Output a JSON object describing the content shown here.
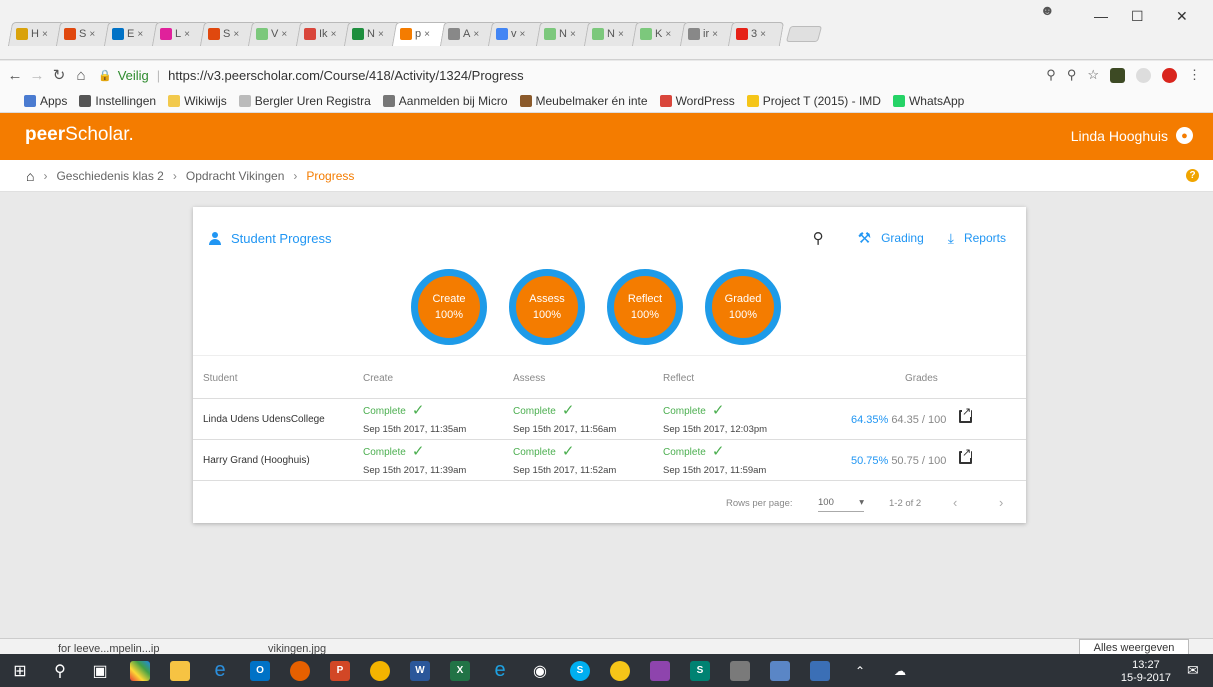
{
  "browser": {
    "tabs": [
      {
        "label": "H",
        "color": "#d9a20b"
      },
      {
        "label": "S",
        "color": "#e0480e"
      },
      {
        "label": "E",
        "color": "#0072c6"
      },
      {
        "label": "L",
        "color": "#e0219b"
      },
      {
        "label": "S",
        "color": "#e0480e"
      },
      {
        "label": "V",
        "color": "#7cc87c"
      },
      {
        "label": "Ik",
        "color": "#d9463b"
      },
      {
        "label": "N",
        "color": "#1e8e3e"
      },
      {
        "label": "p",
        "color": "#f47c00",
        "active": true
      },
      {
        "label": "A",
        "color": "#888888"
      },
      {
        "label": "v",
        "color": "#4285f4"
      },
      {
        "label": "N",
        "color": "#7cc87c"
      },
      {
        "label": "N",
        "color": "#7cc87c"
      },
      {
        "label": "K",
        "color": "#7cc87c"
      },
      {
        "label": "ir",
        "color": "#888888"
      },
      {
        "label": "3",
        "color": "#e62117"
      }
    ],
    "tab_close": "×",
    "secure_label": "Veilig",
    "url": "https://v3.peerscholar.com/Course/418/Activity/1324/Progress",
    "window_controls": {
      "minimize": "—",
      "maximize": "☐",
      "close": "✕"
    },
    "bookmarks": [
      {
        "label": "Apps",
        "color": "#4a7bd0"
      },
      {
        "label": "Instellingen",
        "color": "#555555"
      },
      {
        "label": "Wikiwijs",
        "color": "#f2c94c"
      },
      {
        "label": "Bergler Uren Registra",
        "color": "#bbbbbb"
      },
      {
        "label": "Aanmelden bij Micro",
        "color": "#777777"
      },
      {
        "label": "Meubelmaker én inte",
        "color": "#8b5a2b"
      },
      {
        "label": "WordPress",
        "color": "#d9463b"
      },
      {
        "label": "Project T (2015) - IMD",
        "color": "#f5c518"
      },
      {
        "label": "WhatsApp",
        "color": "#25d366"
      }
    ]
  },
  "app": {
    "logo_peer": "peer",
    "logo_rest": "Scholar.",
    "user_name": "Linda Hooghuis"
  },
  "breadcrumb": {
    "items": [
      "Geschiedenis klas 2",
      "Opdracht Vikingen"
    ],
    "current": "Progress",
    "help": "?"
  },
  "card": {
    "title": "Student Progress",
    "grading_label": "Grading",
    "reports_label": "Reports",
    "circles": [
      {
        "label": "Create",
        "value": "100%"
      },
      {
        "label": "Assess",
        "value": "100%"
      },
      {
        "label": "Reflect",
        "value": "100%"
      },
      {
        "label": "Graded",
        "value": "100%"
      }
    ],
    "columns": {
      "student": "Student",
      "create": "Create",
      "assess": "Assess",
      "reflect": "Reflect",
      "grades": "Grades"
    },
    "rows": [
      {
        "student": "Linda Udens UdensCollege",
        "create": {
          "status": "Complete",
          "date": "Sep 15th 2017, 11:35am"
        },
        "assess": {
          "status": "Complete",
          "date": "Sep 15th 2017, 11:56am"
        },
        "reflect": {
          "status": "Complete",
          "date": "Sep 15th 2017, 12:03pm"
        },
        "grade_pct": "64.35%",
        "grade_pts": "64.35 / 100"
      },
      {
        "student": "Harry Grand (Hooghuis)",
        "create": {
          "status": "Complete",
          "date": "Sep 15th 2017, 11:39am"
        },
        "assess": {
          "status": "Complete",
          "date": "Sep 15th 2017, 11:52am"
        },
        "reflect": {
          "status": "Complete",
          "date": "Sep 15th 2017, 11:59am"
        },
        "grade_pct": "50.75%",
        "grade_pts": "50.75 / 100"
      }
    ],
    "footer": {
      "rows_per_page_label": "Rows per page:",
      "rows_per_page_value": "100",
      "range": "1-2 of 2"
    }
  },
  "shelf": {
    "item1": "for leeve...mpelin...ip",
    "item2": "vikingen.jpg",
    "show_all": "Alles weergeven"
  },
  "taskbar": {
    "time": "13:27",
    "date": "15-9-2017",
    "notifications": "5"
  }
}
